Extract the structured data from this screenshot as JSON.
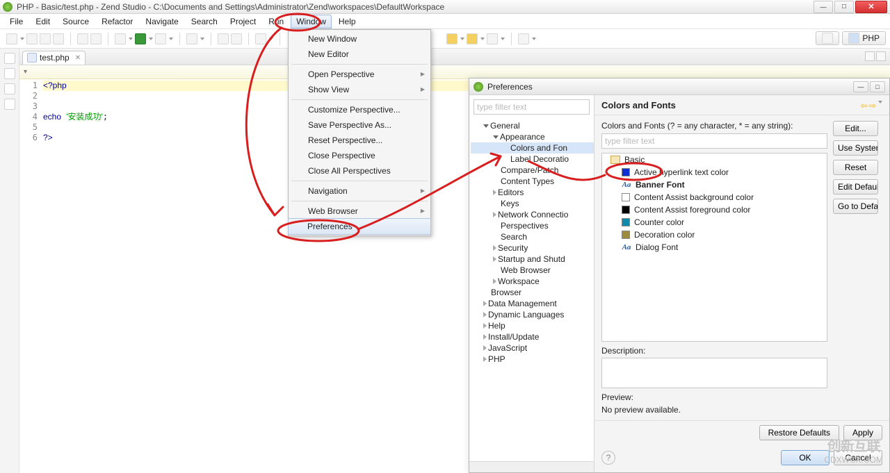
{
  "window": {
    "title": "PHP - Basic/test.php - Zend Studio - C:\\Documents and Settings\\Administrator\\Zend\\workspaces\\DefaultWorkspace"
  },
  "menubar": [
    "File",
    "Edit",
    "Source",
    "Refactor",
    "Navigate",
    "Search",
    "Project",
    "Run",
    "Window",
    "Help"
  ],
  "menubar_open_index": 8,
  "perspective": {
    "label": "PHP"
  },
  "editor": {
    "tab_label": "test.php",
    "lines": [
      "<?php",
      "",
      "echo '安装成功';",
      "",
      "?>",
      ""
    ],
    "linenos": [
      "1",
      "2",
      "3",
      "4",
      "5",
      "6"
    ]
  },
  "window_menu": {
    "items": [
      {
        "label": "New Window"
      },
      {
        "label": "New Editor"
      },
      {
        "sep": true
      },
      {
        "label": "Open Perspective",
        "sub": true
      },
      {
        "label": "Show View",
        "sub": true
      },
      {
        "sep": true
      },
      {
        "label": "Customize Perspective..."
      },
      {
        "label": "Save Perspective As..."
      },
      {
        "label": "Reset Perspective..."
      },
      {
        "label": "Close Perspective"
      },
      {
        "label": "Close All Perspectives"
      },
      {
        "sep": true
      },
      {
        "label": "Navigation",
        "sub": true
      },
      {
        "sep": true
      },
      {
        "label": "Web Browser",
        "sub": true
      },
      {
        "label": "Preferences",
        "highlight": true
      }
    ]
  },
  "preferences": {
    "title": "Preferences",
    "filter_placeholder": "type filter text",
    "tree": [
      {
        "label": "General",
        "depth": 0,
        "open": true
      },
      {
        "label": "Appearance",
        "depth": 1,
        "open": true
      },
      {
        "label": "Colors and Fonts",
        "depth": 2,
        "sel": true,
        "trunc": "Colors and Fon"
      },
      {
        "label": "Label Decorations",
        "depth": 2,
        "trunc": "Label Decoratio"
      },
      {
        "label": "Compare/Patch",
        "depth": 1
      },
      {
        "label": "Content Types",
        "depth": 1
      },
      {
        "label": "Editors",
        "depth": 1,
        "closed": true
      },
      {
        "label": "Keys",
        "depth": 1
      },
      {
        "label": "Network Connections",
        "depth": 1,
        "closed": true,
        "trunc": "Network Connectio"
      },
      {
        "label": "Perspectives",
        "depth": 1
      },
      {
        "label": "Search",
        "depth": 1
      },
      {
        "label": "Security",
        "depth": 1,
        "closed": true
      },
      {
        "label": "Startup and Shutdown",
        "depth": 1,
        "closed": true,
        "trunc": "Startup and Shutd"
      },
      {
        "label": "Web Browser",
        "depth": 1
      },
      {
        "label": "Workspace",
        "depth": 1,
        "closed": true
      },
      {
        "label": "Browser",
        "depth": 0
      },
      {
        "label": "Data Management",
        "depth": 0,
        "closed": true
      },
      {
        "label": "Dynamic Languages",
        "depth": 0,
        "closed": true
      },
      {
        "label": "Help",
        "depth": 0,
        "closed": true
      },
      {
        "label": "Install/Update",
        "depth": 0,
        "closed": true
      },
      {
        "label": "JavaScript",
        "depth": 0,
        "closed": true
      },
      {
        "label": "PHP",
        "depth": 0,
        "closed": true
      }
    ],
    "heading": "Colors and Fonts",
    "hint": "Colors and Fonts (? = any character, * = any string):",
    "filter2_placeholder": "type filter text",
    "cf_items": [
      {
        "type": "folder",
        "label": "Basic",
        "open": true
      },
      {
        "type": "color",
        "label": "Active hyperlink text color",
        "color": "#1030d0"
      },
      {
        "type": "font",
        "label": "Banner Font",
        "bold": true
      },
      {
        "type": "color",
        "label": "Content Assist background color",
        "color": "#ffffff"
      },
      {
        "type": "color",
        "label": "Content Assist foreground color",
        "color": "#000000"
      },
      {
        "type": "color",
        "label": "Counter color",
        "color": "#0f8aa8"
      },
      {
        "type": "color",
        "label": "Decoration color",
        "color": "#9c8b3e"
      },
      {
        "type": "font",
        "label": "Dialog Font"
      }
    ],
    "buttons_side": [
      "Edit...",
      "Use System Font",
      "Reset",
      "Edit Default...",
      "Go to Default"
    ],
    "desc_label": "Description:",
    "preview_label": "Preview:",
    "preview_text": "No preview available.",
    "restore_defaults": "Restore Defaults",
    "apply": "Apply",
    "ok": "OK",
    "cancel": "Cancel"
  },
  "watermark": {
    "big": "创新互联",
    "small": "CDXWCX.COM"
  }
}
